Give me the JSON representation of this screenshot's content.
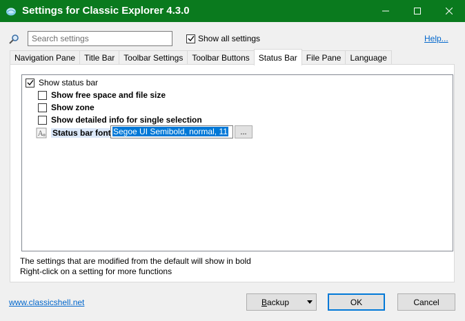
{
  "window": {
    "title": "Settings for Classic Explorer 4.3.0",
    "accent_color": "#0a7a1e"
  },
  "search": {
    "placeholder": "Search settings",
    "show_all_label": "Show all settings",
    "show_all_checked": true,
    "help_label": "Help..."
  },
  "tabs": [
    {
      "label": "Navigation Pane",
      "active": false
    },
    {
      "label": "Title Bar",
      "active": false
    },
    {
      "label": "Toolbar Settings",
      "active": false
    },
    {
      "label": "Toolbar Buttons",
      "active": false
    },
    {
      "label": "Status Bar",
      "active": true
    },
    {
      "label": "File Pane",
      "active": false
    },
    {
      "label": "Language",
      "active": false
    }
  ],
  "settings": {
    "show_status_bar": {
      "label": "Show status bar",
      "checked": true
    },
    "show_free_space": {
      "label": "Show free space and file size",
      "checked": false
    },
    "show_zone": {
      "label": "Show zone",
      "checked": false
    },
    "show_detailed_info": {
      "label": "Show detailed info for single selection",
      "checked": false
    },
    "status_bar_font": {
      "label": "Status bar font",
      "value": "Segoe UI Semibold, normal, 11",
      "browse_label": "..."
    }
  },
  "notes": {
    "bold_note": "The settings that are modified from the default will show in bold",
    "rightclick_note": "Right-click on a setting for more functions"
  },
  "footer": {
    "site_link": "www.classicshell.net",
    "backup_label_prefix": "",
    "backup_accel": "B",
    "backup_label_rest": "ackup",
    "ok_label": "OK",
    "cancel_label": "Cancel"
  },
  "icons": {
    "app": "shell-icon",
    "search": "search-icon",
    "minimize": "minimize-icon",
    "maximize": "maximize-icon",
    "close": "close-icon",
    "font": "font-icon",
    "dropdown": "dropdown-arrow-icon"
  }
}
